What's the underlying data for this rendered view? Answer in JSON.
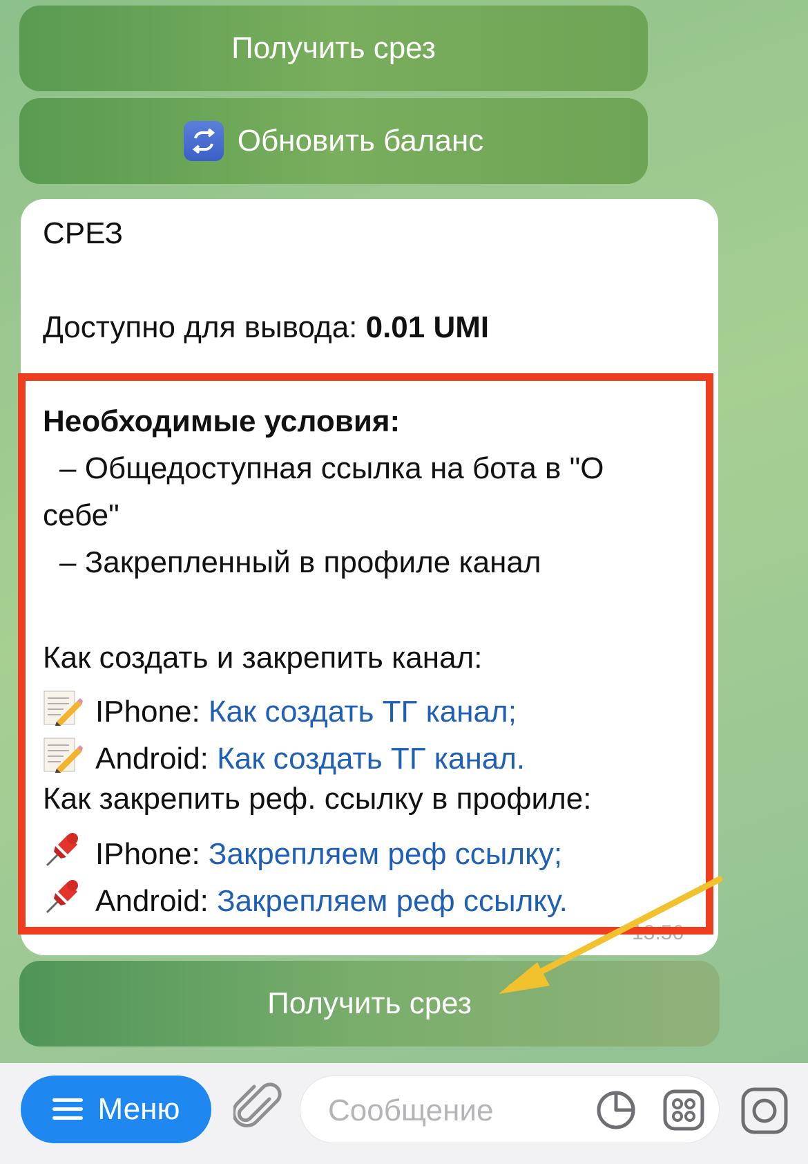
{
  "buttons": {
    "get_cut_top": "Получить срез",
    "refresh_balance": "Обновить баланс",
    "refresh_balance_icon": "repeat-arrows-icon",
    "get_cut_bottom": "Получить срез"
  },
  "message": {
    "title": "СРЕЗ",
    "available_label": "Доступно для вывода: ",
    "available_value": "0.01 UMI",
    "conditions_heading": "Необходимые условия:",
    "condition_1_line1": "– Общедоступная ссылка на бота в \"О",
    "condition_1_line2": "себе\"",
    "condition_2": "– Закрепленный в профиле канал",
    "how_create_heading": "Как создать и закрепить канал:",
    "create_iphone_label": "IPhone: ",
    "create_iphone_link": "Как создать ТГ канал;",
    "create_android_label": "Android: ",
    "create_android_link": "Как создать ТГ канал.",
    "how_pin_heading": "Как закрепить реф. ссылку в профиле:",
    "pin_iphone_label": "IPhone: ",
    "pin_iphone_link": "Закрепляем реф ссылку;",
    "pin_android_label": "Android: ",
    "pin_android_link": "Закрепляем реф ссылку.",
    "time": "13:56"
  },
  "composer": {
    "menu_label": "Меню",
    "placeholder": "Сообщение"
  },
  "colors": {
    "highlight": "#ef3d1f",
    "arrow": "#f2c12e",
    "link": "#1f5fb5",
    "menu_button": "#1e88f0"
  }
}
